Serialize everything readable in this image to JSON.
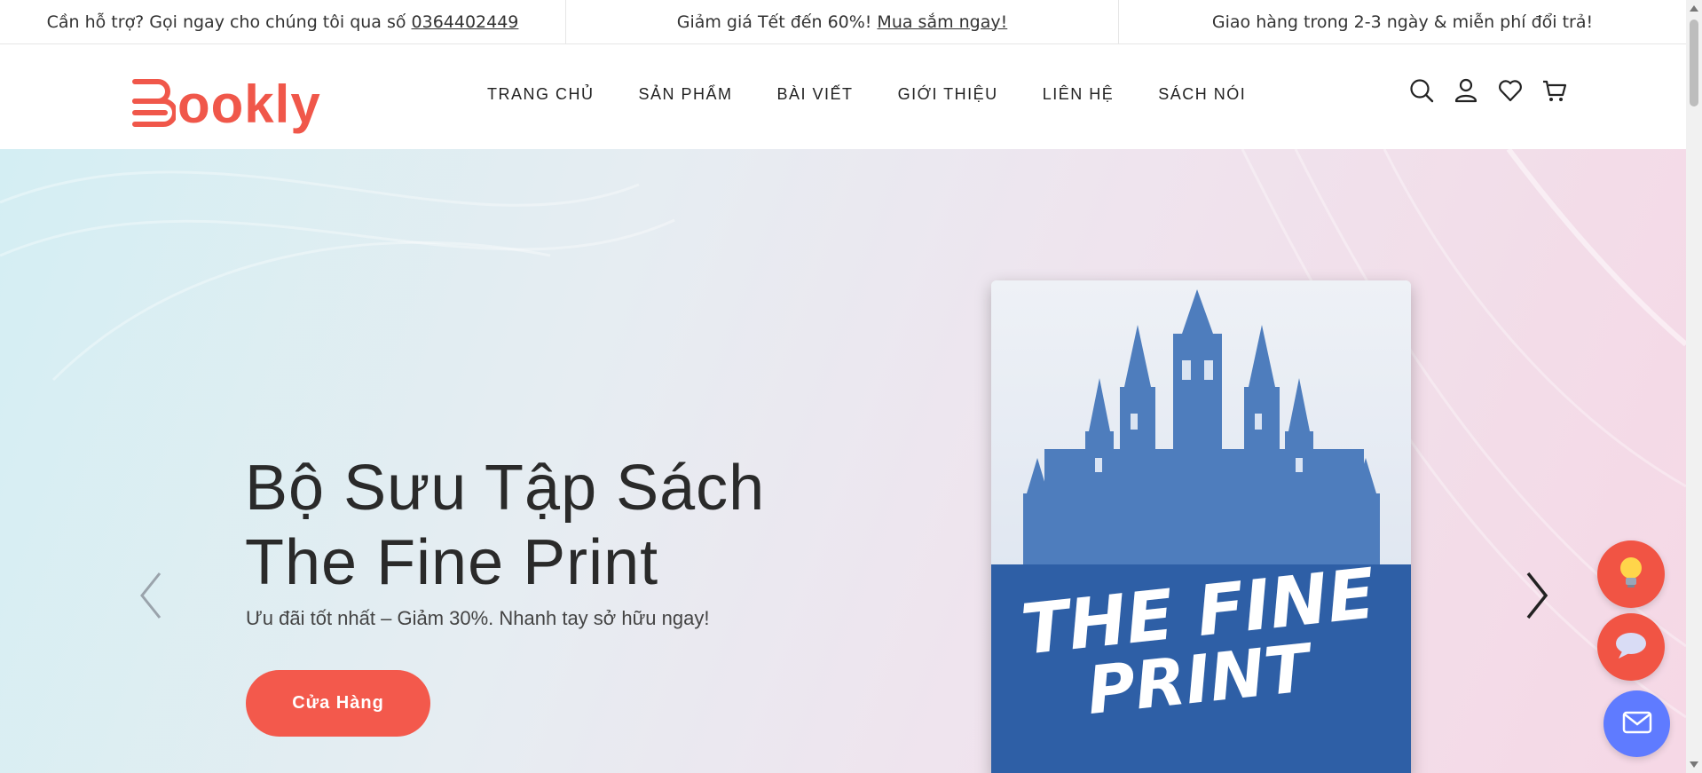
{
  "topbar": {
    "support_text": "Cần hỗ trợ? Gọi ngay cho chúng tôi qua số",
    "support_phone": "0364402449",
    "sale_text": "Giảm giá Tết đến 60%!",
    "sale_link": "Mua sắm ngay!",
    "shipping_text": "Giao hàng trong 2-3 ngày & miễn phí đổi trả!"
  },
  "header": {
    "logo_text": "ookly",
    "nav": [
      "TRANG CHỦ",
      "SẢN PHẨM",
      "BÀI VIẾT",
      "GIỚI THIỆU",
      "LIÊN HỆ",
      "SÁCH NÓI"
    ],
    "icons": [
      "search-icon",
      "user-icon",
      "heart-icon",
      "cart-icon"
    ]
  },
  "hero": {
    "title_line1": "Bộ Sưu Tập Sách",
    "title_line2": "The Fine Print",
    "subtitle": "Ưu đãi tốt nhất – Giảm 30%. Nhanh tay sở hữu ngay!",
    "button_label": "Cửa Hàng",
    "book_cover_text_1": "THE FINE",
    "book_cover_text_2": "PRINT"
  },
  "colors": {
    "brand": "#f0574a",
    "button": "#f3594c",
    "mail_fab": "#5f7bff"
  }
}
